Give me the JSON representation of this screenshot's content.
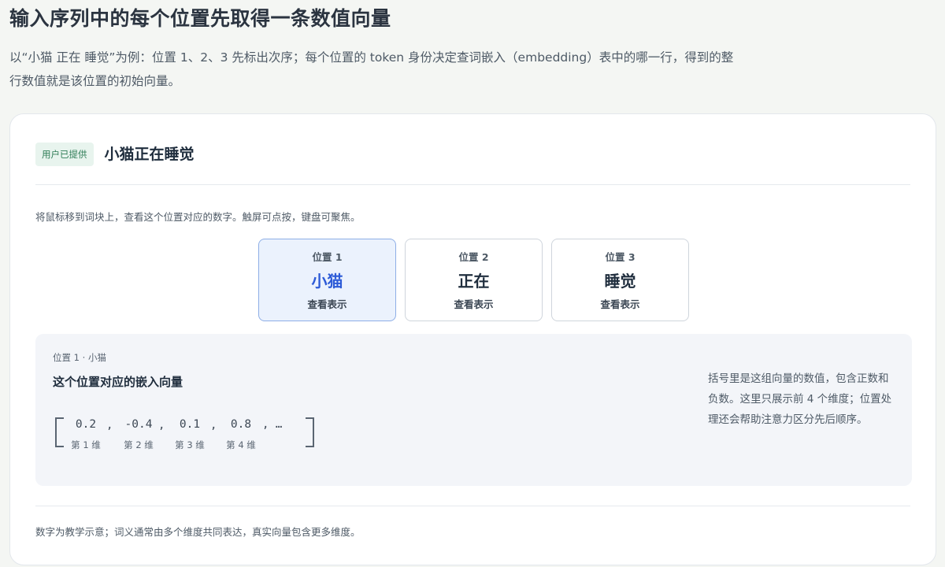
{
  "page": {
    "title": "输入序列中的每个位置先取得一条数值向量",
    "intro": "以“小猫 正在 睡觉”为例：位置 1、2、3 先标出次序；每个位置的 token 身份决定查词嵌入（embedding）表中的哪一行，得到的整行数值就是该位置的初始向量。"
  },
  "card": {
    "badge": "用户已提供",
    "title": "小猫正在睡觉",
    "hint": "将鼠标移到词块上，查看这个位置对应的数字。触屏可点按，键盘可聚焦。",
    "tokens": [
      {
        "position": "位置 1",
        "word": "小猫",
        "action": "查看表示",
        "active": true
      },
      {
        "position": "位置 2",
        "word": "正在",
        "action": "查看表示",
        "active": false
      },
      {
        "position": "位置 3",
        "word": "睡觉",
        "action": "查看表示",
        "active": false
      }
    ],
    "detail": {
      "crumb": "位置 1 · 小猫",
      "heading": "这个位置对应的嵌入向量",
      "vector": [
        {
          "value": "0.2",
          "dim": "第 1 维"
        },
        {
          "value": "-0.4",
          "dim": "第 2 维"
        },
        {
          "value": "0.1",
          "dim": "第 3 维"
        },
        {
          "value": "0.8",
          "dim": "第 4 维"
        }
      ],
      "separator": ",",
      "ellipsis": ", …",
      "note": "括号里是这组向量的数值，包含正数和负数。这里只展示前 4 个维度；位置处理还会帮助注意力区分先后顺序。"
    },
    "footnote": "数字为教学示意；词义通常由多个维度共同表达，真实向量包含更多维度。"
  },
  "colors": {
    "accent": "#2d5bd7",
    "active_bg": "#ebf2fd",
    "badge_bg": "#e8f4ee",
    "badge_text": "#2f7d57"
  }
}
